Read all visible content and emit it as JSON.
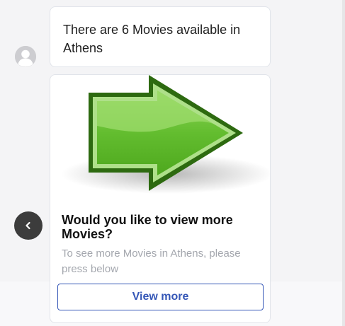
{
  "message": {
    "text": "There are 6 Movies available in Athens",
    "avatar_icon": "user-avatar-icon"
  },
  "card": {
    "image_icon": "green-right-arrow-icon",
    "title": "Would you like to view more Movies?",
    "subtitle": "To see more Movies in Athens, please press below",
    "button_label": "View more"
  },
  "carousel": {
    "back_icon": "chevron-left-icon"
  },
  "colors": {
    "accent": "#3557b7",
    "avatar": "#cdcdd1",
    "back_button": "#3c3c3c",
    "arrow_green": "#5cb82a",
    "arrow_dark": "#2d6a10"
  }
}
